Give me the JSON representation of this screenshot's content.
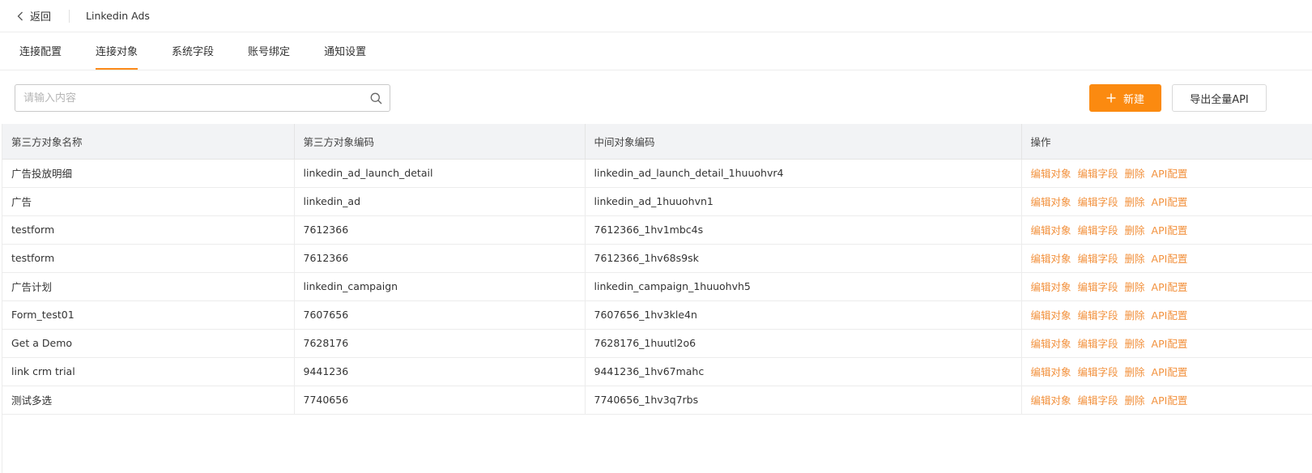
{
  "header": {
    "back_label": "返回",
    "title": "Linkedin Ads"
  },
  "tabs": [
    {
      "label": "连接配置",
      "active": false
    },
    {
      "label": "连接对象",
      "active": true
    },
    {
      "label": "系统字段",
      "active": false
    },
    {
      "label": "账号绑定",
      "active": false
    },
    {
      "label": "通知设置",
      "active": false
    }
  ],
  "toolbar": {
    "search_placeholder": "请输入内容",
    "search_value": "",
    "new_label": "新建",
    "export_label": "导出全量API"
  },
  "colors": {
    "accent": "#fb8a10",
    "link": "#f2913d"
  },
  "table": {
    "columns": [
      "第三方对象名称",
      "第三方对象编码",
      "中间对象编码",
      "操作"
    ],
    "actions": [
      "编辑对象",
      "编辑字段",
      "删除",
      "API配置"
    ],
    "rows": [
      [
        "广告投放明细",
        "linkedin_ad_launch_detail",
        "linkedin_ad_launch_detail_1huuohvr4"
      ],
      [
        "广告",
        "linkedin_ad",
        "linkedin_ad_1huuohvn1"
      ],
      [
        "testform",
        "7612366",
        "7612366_1hv1mbc4s"
      ],
      [
        "testform",
        "7612366",
        "7612366_1hv68s9sk"
      ],
      [
        "广告计划",
        "linkedin_campaign",
        "linkedin_campaign_1huuohvh5"
      ],
      [
        "Form_test01",
        "7607656",
        "7607656_1hv3kle4n"
      ],
      [
        "Get a Demo",
        "7628176",
        "7628176_1huutl2o6"
      ],
      [
        "link crm trial",
        "9441236",
        "9441236_1hv67mahc"
      ],
      [
        "测试多选",
        "7740656",
        "7740656_1hv3q7rbs"
      ]
    ]
  }
}
